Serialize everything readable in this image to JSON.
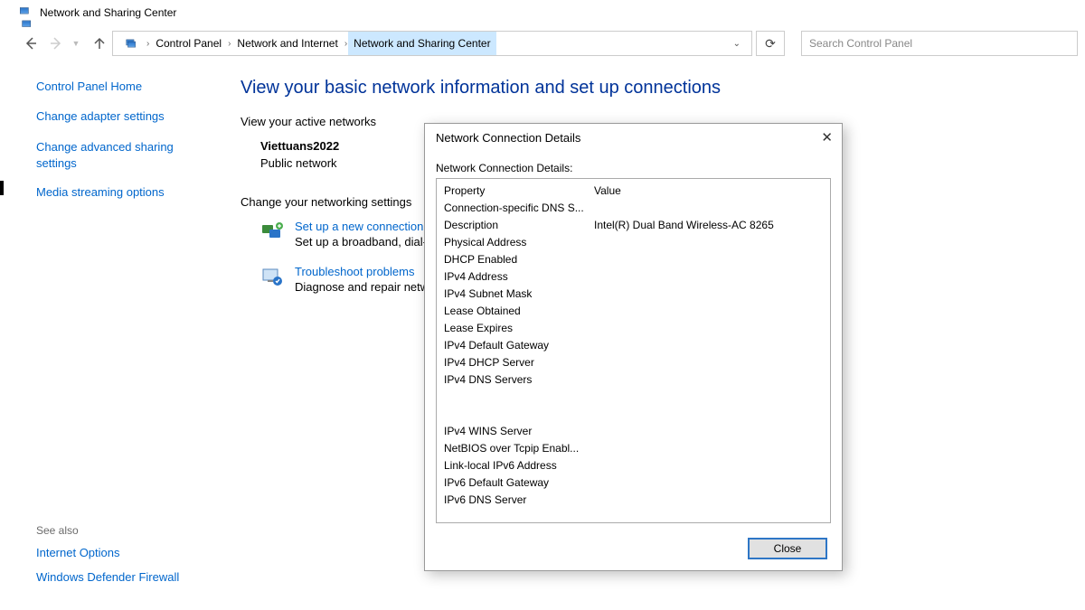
{
  "titlebar": {
    "title": "Network and Sharing Center"
  },
  "nav": {
    "breadcrumb": [
      "Control Panel",
      "Network and Internet",
      "Network and Sharing Center"
    ],
    "search_placeholder": "Search Control Panel"
  },
  "sidebar": {
    "home": "Control Panel Home",
    "links": [
      "Change adapter settings",
      "Change advanced sharing settings",
      "Media streaming options"
    ],
    "see_also_header": "See also",
    "see_also": [
      "Internet Options",
      "Windows Defender Firewall"
    ]
  },
  "main": {
    "heading": "View your basic network information and set up connections",
    "active_label": "View your active networks",
    "network_name": "Viettuans2022",
    "network_type": "Public network",
    "change_label": "Change your networking settings",
    "tasks": [
      {
        "title": "Set up a new connection or network",
        "desc": "Set up a broadband, dial-up, or VPN connection; or set up a router or access point."
      },
      {
        "title": "Troubleshoot problems",
        "desc": "Diagnose and repair network problems, or get troubleshooting information."
      }
    ]
  },
  "dialog": {
    "title": "Network Connection Details",
    "label": "Network Connection Details:",
    "header_prop": "Property",
    "header_val": "Value",
    "rows_top": [
      {
        "p": "Connection-specific DNS S...",
        "v": ""
      },
      {
        "p": "Description",
        "v": "Intel(R) Dual Band Wireless-AC 8265"
      },
      {
        "p": "Physical Address",
        "v": ""
      },
      {
        "p": "DHCP Enabled",
        "v": ""
      },
      {
        "p": "IPv4 Address",
        "v": ""
      },
      {
        "p": "IPv4 Subnet Mask",
        "v": ""
      },
      {
        "p": "Lease Obtained",
        "v": ""
      },
      {
        "p": "Lease Expires",
        "v": ""
      },
      {
        "p": "IPv4 Default Gateway",
        "v": ""
      },
      {
        "p": "IPv4 DHCP Server",
        "v": ""
      },
      {
        "p": "IPv4 DNS Servers",
        "v": ""
      }
    ],
    "rows_bottom": [
      {
        "p": "IPv4 WINS Server",
        "v": ""
      },
      {
        "p": "NetBIOS over Tcpip Enabl...",
        "v": ""
      },
      {
        "p": "Link-local IPv6 Address",
        "v": ""
      },
      {
        "p": "IPv6 Default Gateway",
        "v": ""
      },
      {
        "p": "IPv6 DNS Server",
        "v": ""
      }
    ],
    "close": "Close"
  }
}
